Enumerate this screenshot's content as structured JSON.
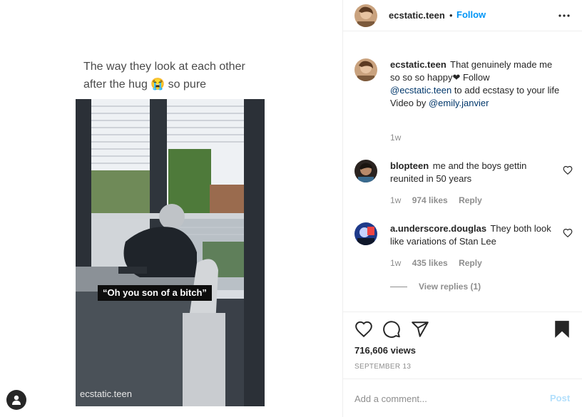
{
  "media": {
    "caption_line1": "The way they look at each other",
    "caption_line2": "after the hug",
    "caption_emoji": "😭",
    "caption_end": "so pure",
    "subtitle": "“Oh you son of a bitch”",
    "watermark": "ecstatic.teen",
    "profile_icon": "person-icon"
  },
  "header": {
    "username": "ecstatic.teen",
    "separator": "•",
    "follow_label": "Follow",
    "more_icon": "more-horizontal-icon"
  },
  "caption": {
    "username": "ecstatic.teen",
    "text_part1": "That genuinely made me so so so happy",
    "heart": "❤",
    "text_part2": "Follow",
    "mention1": "@ecstatic.teen",
    "text_part3": "to add ecstasy to your life",
    "text_part4": "Video by",
    "mention2": "@emily.janvier",
    "time": "1w"
  },
  "comments": [
    {
      "username": "blopteen",
      "text": "me and the boys gettin reunited in 50 years",
      "time": "1w",
      "likes": "974 likes",
      "reply": "Reply"
    },
    {
      "username": "a.underscore.douglas",
      "text": "They both look like variations of Stan Lee",
      "time": "1w",
      "likes": "435 likes",
      "reply": "Reply",
      "view_replies": "View replies (1)"
    }
  ],
  "actions": {
    "like_icon": "heart-icon",
    "comment_icon": "comment-icon",
    "share_icon": "share-icon",
    "save_icon": "bookmark-icon",
    "views": "716,606 views",
    "date": "SEPTEMBER 13"
  },
  "add_comment": {
    "placeholder": "Add a comment...",
    "post_label": "Post"
  },
  "colors": {
    "link": "#0095f6",
    "mention": "#00376b",
    "muted": "#8e8e8e",
    "post_disabled": "#b2dffc"
  }
}
